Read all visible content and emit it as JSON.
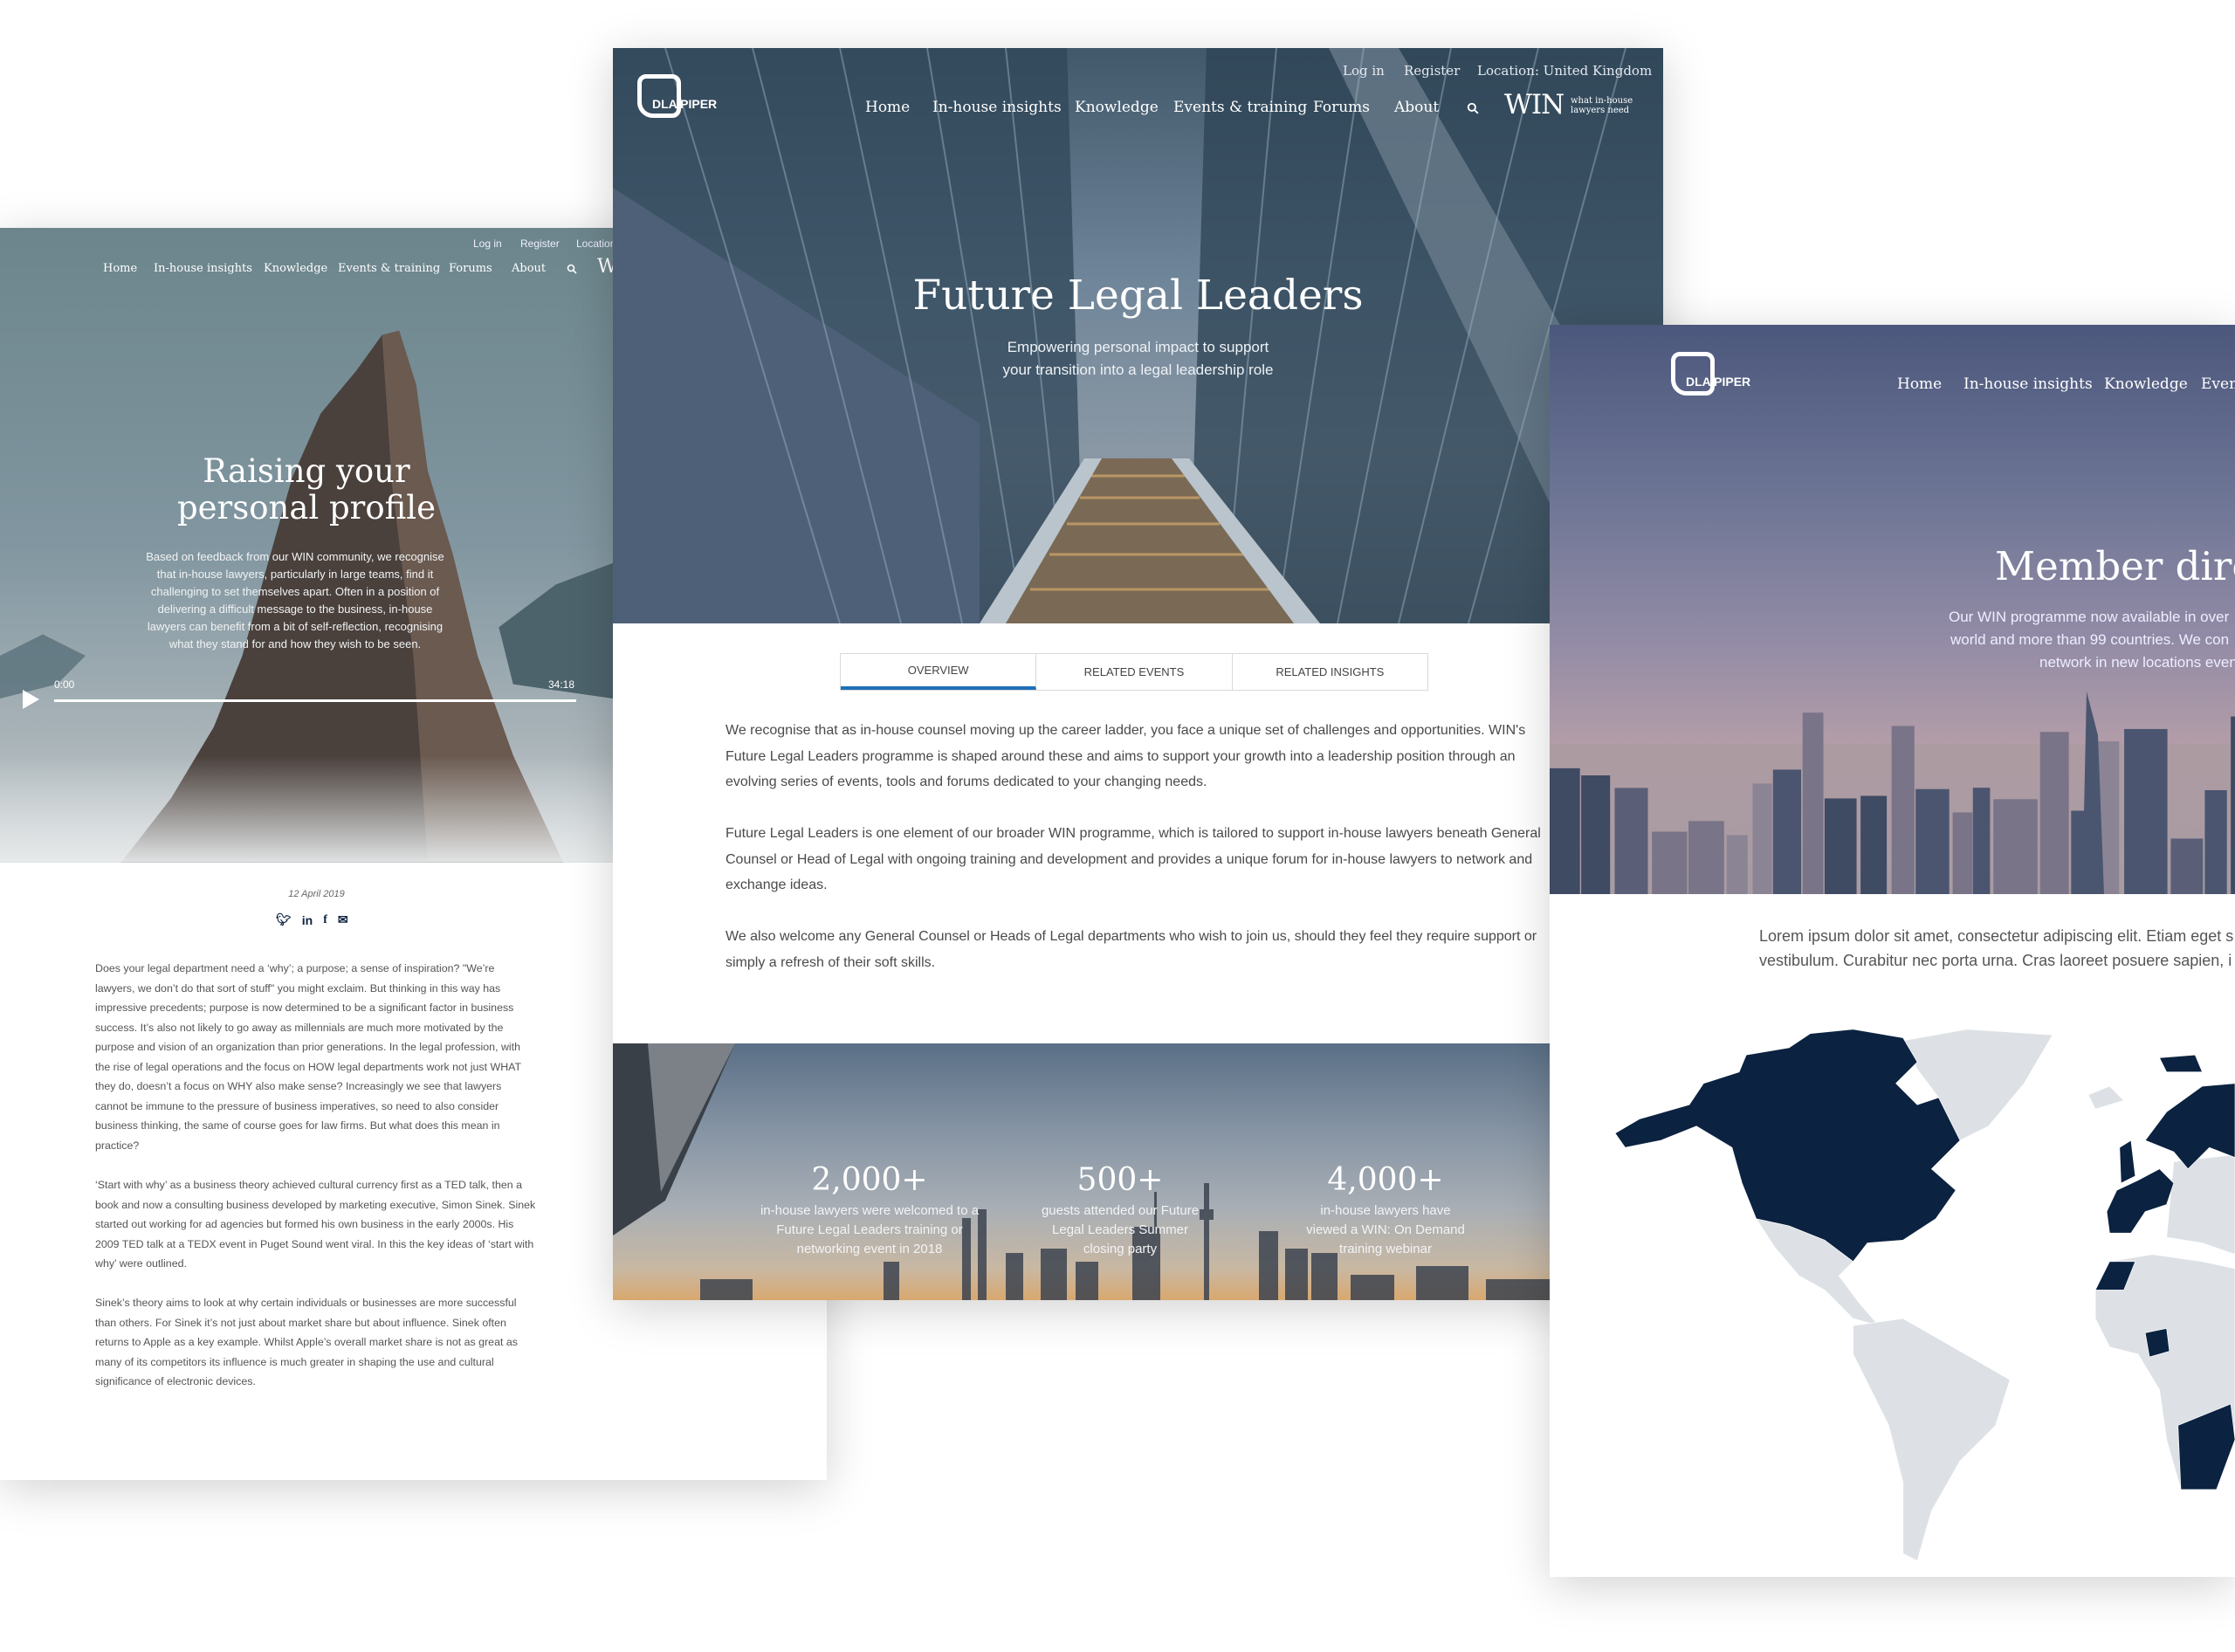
{
  "colors": {
    "accent": "#1f6fb8",
    "map_member": "#0b2240",
    "map_other": "#dde1e6",
    "body_text": "#4a4a4a"
  },
  "left_page": {
    "top_links": [
      "Log in",
      "Register",
      "Location"
    ],
    "nav": [
      "Home",
      "In-house insights",
      "Knowledge",
      "Events & training",
      "Forums",
      "About"
    ],
    "search_icon": "search-icon",
    "win_logo_fragment": "W",
    "hero": {
      "title_line1": "Raising your",
      "title_line2": "personal profile",
      "description": "Based on feedback from our WIN community, we recognise that in-house lawyers, particularly in large teams, find it challenging to set themselves apart. Often in a position of delivering a difficult message to the business, in-house lawyers can benefit from a bit of self-reflection, recognising what they stand for and how they wish to be seen."
    },
    "video": {
      "current_time": "0:00",
      "duration": "34:18",
      "progress": 0
    },
    "date": "12 April 2019",
    "share_icons": [
      "twitter-icon",
      "linkedin-icon",
      "facebook-icon",
      "email-icon"
    ],
    "paragraphs": [
      "Does your legal department need a ‘why’; a purpose; a sense of inspiration? \"We’re lawyers, we don’t do that sort of stuff\" you might exclaim. But thinking in this way has impressive precedents; purpose is now determined to be a significant factor in business success. It’s also not likely to go away as millennials are much more motivated by the purpose and vision of an organization than prior generations. In the legal profession, with the rise of legal operations and the focus on HOW legal departments work not just WHAT they do, doesn’t a focus on WHY also make sense? Increasingly we see that lawyers cannot be immune to the pressure of business imperatives, so need to also consider business thinking, the same of course goes for law firms. But what does this mean in practice?",
      "‘Start with why’ as a business theory achieved cultural currency first as a TED talk, then a book and now a consulting business developed by marketing executive, Simon Sinek. Sinek started out working for ad agencies but formed his own business in the early 2000s. His 2009 TED talk at a TEDX event in Puget Sound went viral. In this the key ideas of ‘start with why’ were outlined.",
      "Sinek’s theory aims to look at why certain individuals or businesses are more successful than others. For Sinek it’s not just about market share but about influence. Sinek often returns to Apple as a key example. Whilst Apple’s overall market share is not as great as many of its competitors its influence is much greater in shaping the use and cultural significance of electronic devices."
    ]
  },
  "center_page": {
    "logo": "DLA PIPER",
    "top_links": [
      "Log in",
      "Register",
      "Location: United Kingdom"
    ],
    "nav": [
      "Home",
      "In-house insights",
      "Knowledge",
      "Events & training",
      "Forums",
      "About"
    ],
    "win": {
      "mark": "WIN",
      "tagline_line1": "what in-house",
      "tagline_line2": "lawyers need"
    },
    "hero": {
      "title": "Future Legal Leaders",
      "subtitle_line1": "Empowering personal impact to support",
      "subtitle_line2": "your transition into a legal leadership role"
    },
    "tabs": [
      {
        "label": "OVERVIEW",
        "active": true
      },
      {
        "label": "RELATED EVENTS",
        "active": false
      },
      {
        "label": "RELATED INSIGHTS",
        "active": false
      }
    ],
    "paragraphs": [
      "We recognise that as in-house counsel moving up the career ladder, you face a unique set of challenges and opportunities. WIN's Future Legal Leaders programme is shaped around these and aims to support your growth into a leadership position through an evolving series of events, tools and forums dedicated to your changing needs.",
      "Future Legal Leaders is one element of our broader WIN programme, which is tailored to support in-house lawyers beneath General Counsel or Head of Legal with ongoing training and development and provides a unique forum for in-house lawyers to network and exchange ideas.",
      "We also welcome any General Counsel or Heads of Legal departments who wish to join us, should they feel they require support or simply a refresh of their soft skills."
    ],
    "stats": [
      {
        "value": "2,000+",
        "text": "in-house lawyers were welcomed to a Future Legal Leaders training or networking event in 2018"
      },
      {
        "value": "500+",
        "text": "guests attended our Future Legal Leaders Summer closing party"
      },
      {
        "value": "4,000+",
        "text": "in-house lawyers have viewed a WIN: On Demand training webinar"
      }
    ]
  },
  "right_page": {
    "logo": "DLA PIPER",
    "nav": [
      "Home",
      "In-house insights",
      "Knowledge",
      "Even"
    ],
    "hero": {
      "title": "Member dire",
      "subtitle_lines": [
        "Our WIN programme now available in over",
        "world and more than 99 countries. We con",
        "network in new locations even"
      ]
    },
    "lorem_lines": [
      "Lorem ipsum dolor sit amet, consectetur adipiscing elit. Etiam eget s",
      "vestibulum. Curabitur nec porta urna. Cras laoreet posuere sapien, i"
    ]
  }
}
